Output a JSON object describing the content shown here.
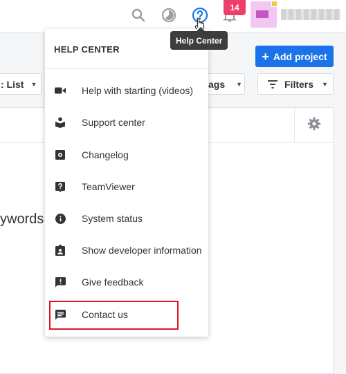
{
  "header": {
    "notification_count": "14",
    "tooltip": "Help Center"
  },
  "toolbar": {
    "add_project_label": "Add project",
    "view_select_label": ": List",
    "tags_label": "ags",
    "filters_label": "Filters"
  },
  "content": {
    "keywords_fragment": "ywords."
  },
  "help_menu": {
    "title": "HELP CENTER",
    "items": [
      {
        "label": "Help with starting (videos)",
        "icon": "video-camera-icon"
      },
      {
        "label": "Support center",
        "icon": "book-reader-icon"
      },
      {
        "label": "Changelog",
        "icon": "settings-box-icon"
      },
      {
        "label": "TeamViewer",
        "icon": "help-box-icon"
      },
      {
        "label": "System status",
        "icon": "info-icon"
      },
      {
        "label": "Show developer information",
        "icon": "badge-icon"
      },
      {
        "label": "Give feedback",
        "icon": "feedback-icon"
      },
      {
        "label": "Contact us",
        "icon": "chat-icon"
      }
    ]
  },
  "colors": {
    "accent": "#1a73e8",
    "badge": "#f03e6a",
    "highlight": "#e0141e"
  }
}
